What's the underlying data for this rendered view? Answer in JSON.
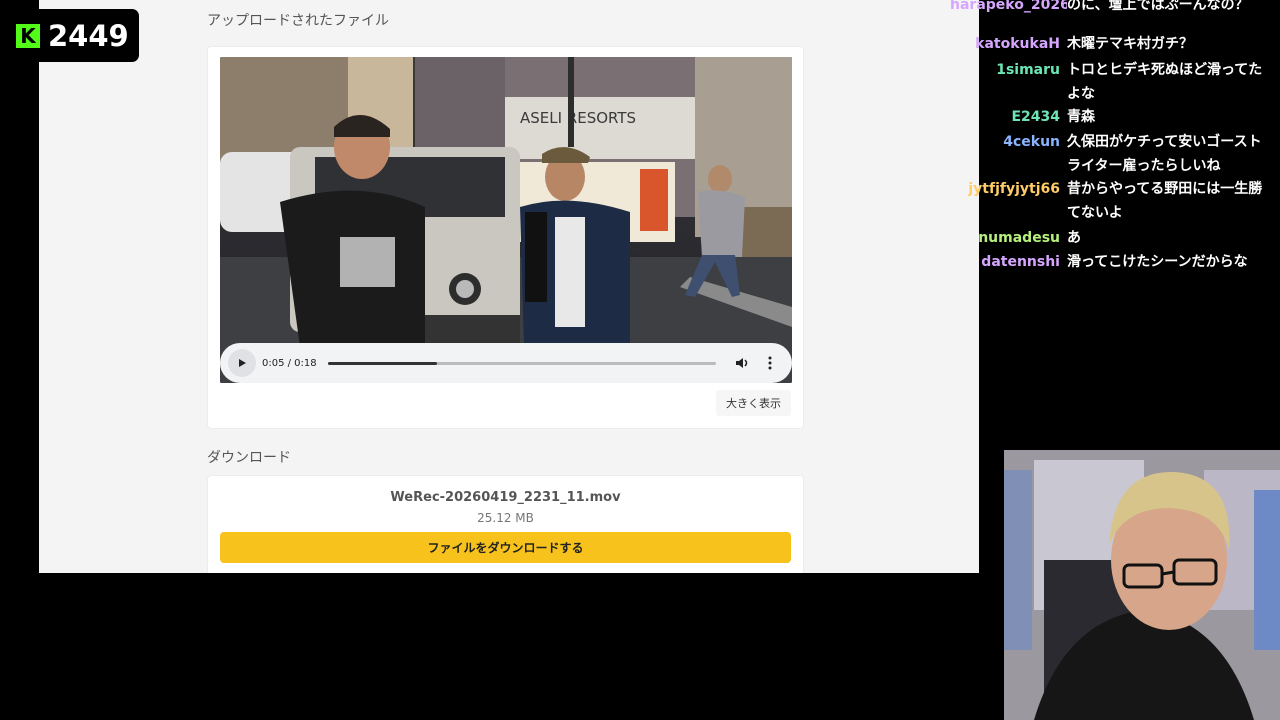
{
  "viewers": {
    "count": "2449",
    "logo_letter": "K",
    "accent": "#53fc18"
  },
  "page": {
    "uploaded_title": "アップロードされたファイル",
    "player": {
      "time": "0:05 / 0:18",
      "progress": 0.28,
      "enlarge_label": "大きく表示",
      "signage": "ASELI RESORTS"
    },
    "download_title": "ダウンロード",
    "file": {
      "name": "WeRec-20260419_2231_11.mov",
      "size": "25.12 MB",
      "button_label": "ファイルをダウンロードする",
      "button_color": "#f6c21b"
    }
  },
  "chat": {
    "partial_top": "のに、壇上ではぷーんなの？",
    "partial_top_user": "harapeko_2026",
    "messages": [
      {
        "user": "katokukaH",
        "color": "#d6a6ff",
        "text": "木曜テマキ村ガチ？"
      },
      {
        "user": "1simaru",
        "color": "#6be6b4",
        "text": "トロとヒデキ死ぬほど滑ってたよな"
      },
      {
        "user": "E2434",
        "color": "#6be6b4",
        "text": "青森"
      },
      {
        "user": "4cekun",
        "color": "#8ab4ff",
        "text": "久保田がケチって安いゴーストライター雇ったらしいね"
      },
      {
        "user": "jytfjfyjytj66",
        "color": "#ffcc66",
        "text": "昔からやってる野田には一生勝てないよ"
      },
      {
        "user": "numadesu",
        "color": "#b6f07a",
        "text": "あ"
      },
      {
        "user": "datennshi",
        "color": "#d6a6ff",
        "text": "滑ってこけたシーンだからな"
      }
    ]
  }
}
